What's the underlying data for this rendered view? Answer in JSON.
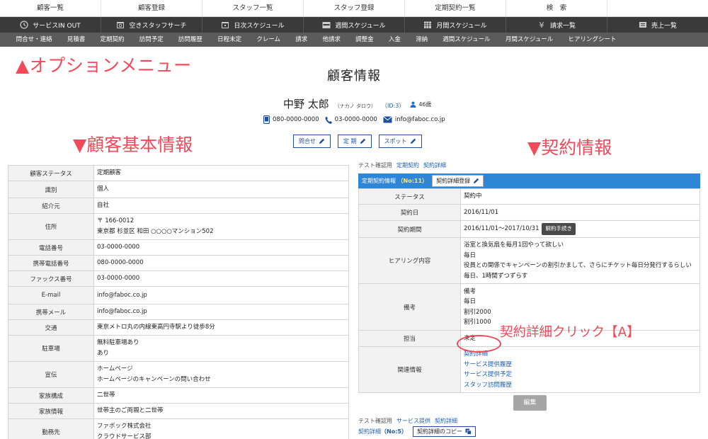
{
  "nav1": [
    "顧客一覧",
    "顧客登録",
    "スタッフ一覧",
    "スタッフ登録",
    "定期契約一覧",
    "検　索",
    ""
  ],
  "nav2": [
    {
      "label": "サービスIN OUT",
      "icon": "clock-icon"
    },
    {
      "label": "空きスタッフサーチ",
      "icon": "calendar-search-icon"
    },
    {
      "label": "日次スケジュール",
      "icon": "calendar-day-icon"
    },
    {
      "label": "週間スケジュール",
      "icon": "calendar-week-icon"
    },
    {
      "label": "月間スケジュール",
      "icon": "calendar-month-icon"
    },
    {
      "label": "請求一覧",
      "icon": "yen-icon"
    },
    {
      "label": "売上一覧",
      "icon": "list-icon"
    }
  ],
  "nav3": [
    "問合せ・連絡",
    "見積書",
    "定期契約",
    "訪問予定",
    "訪問履歴",
    "日程未定",
    "クレーム",
    "請求",
    "他請求",
    "調整金",
    "入金",
    "滞納",
    "週間スケジュール",
    "月間スケジュール",
    "ヒアリングシート"
  ],
  "annotations": {
    "option_menu": "▲オプションメニュー",
    "basic_info": "▼顧客基本情報",
    "contract_info": "▼契約情報",
    "click_note": "契約詳細クリック【A】"
  },
  "page_title": "顧客情報",
  "customer": {
    "name": "中野 太郎",
    "kana": "（ナカノ タロウ）",
    "id": "（ID:3）",
    "age": "46歳",
    "mobile": "080-0000-0000",
    "phone": "03-0000-0000",
    "email": "info@faboc.co.jp"
  },
  "action_buttons": [
    "問合せ",
    "定 期",
    "スポット"
  ],
  "basic_table": [
    {
      "label": "顧客ステータス",
      "lines": [
        "定期顧客"
      ]
    },
    {
      "label": "識別",
      "lines": [
        "個人"
      ]
    },
    {
      "label": "紹介元",
      "lines": [
        "自社"
      ]
    },
    {
      "label": "住所",
      "lines": [
        "〒 166-0012",
        "東京都 杉並区 和田 ○○○○マンション502"
      ]
    },
    {
      "label": "電話番号",
      "lines": [
        "03-0000-0000"
      ]
    },
    {
      "label": "携帯電話番号",
      "lines": [
        "080-0000-0000"
      ]
    },
    {
      "label": "ファックス番号",
      "lines": [
        "03-0000-0000"
      ]
    },
    {
      "label": "E-mail",
      "lines": [
        "info@faboc.co.jp"
      ]
    },
    {
      "label": "携帯メール",
      "lines": [
        "info@faboc.co.jp"
      ]
    },
    {
      "label": "交通",
      "lines": [
        "東京メトロ丸の内線東高円寺駅より徒歩8分"
      ]
    },
    {
      "label": "駐車場",
      "lines": [
        "無料駐車場あり",
        "あり"
      ]
    },
    {
      "label": "宣伝",
      "lines": [
        "ホームページ",
        "ホームページのキャンペーンの問い合わせ"
      ]
    },
    {
      "label": "家族構成",
      "lines": [
        "二世帯"
      ]
    },
    {
      "label": "家族情報",
      "lines": [
        "世帯主のご両親と二世帯"
      ]
    },
    {
      "label": "勤務先",
      "lines": [
        "ファボック株式会社",
        "クラウドサービス部"
      ]
    }
  ],
  "contract_links": {
    "prefix": "テスト確認用",
    "link1": "定期契約",
    "link2": "契約詳細"
  },
  "contract_header": {
    "title": "定期契約情報",
    "no": "（No:11）",
    "button": "契約詳細登録"
  },
  "contract_table": {
    "status_label": "ステータス",
    "status": "契約中",
    "date_label": "契約日",
    "date": "2016/11/01",
    "period_label": "契約期間",
    "period": "2016/11/01～2017/10/31",
    "period_badge": "解約手続き",
    "hearing_label": "ヒアリング内容",
    "hearing": [
      "浴室と換気扇を毎月1回やって欲しい",
      "毎日",
      "役員との関係でキャンペーンの割引かまして、さらにチケット毎日分発行するらしい",
      "毎日、1時間ずつずらす"
    ],
    "memo_label": "備考",
    "memo": [
      "備考",
      "毎日",
      "割引2000",
      "割引1000"
    ],
    "staff_label": "担当",
    "staff": "未定",
    "related_label": "関連情報",
    "related": [
      "契約詳細",
      "サービス提供履歴",
      "サービス提供予定",
      "スタッフ訪問履歴"
    ]
  },
  "edit_button": "編集",
  "detail_links": {
    "prefix": "テスト確認用",
    "link1": "サービス提供",
    "link2": "契約詳細"
  },
  "detail_row": {
    "title": "契約詳細",
    "no": "（No:5）",
    "button": "契約詳細のコピー"
  }
}
